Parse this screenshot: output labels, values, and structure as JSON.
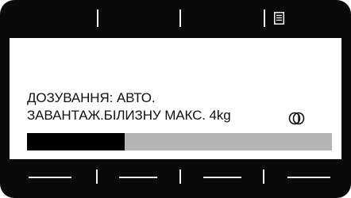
{
  "display": {
    "dosing_line": "ДОЗУВАННЯ: АВТО.",
    "load_line": "ЗАВАНТАЖ.БІЛИЗНУ МАКС. 4kg"
  },
  "icons": {
    "top_right": "menu-list-icon",
    "load_indicator": "drum-icon"
  },
  "progress": {
    "fraction": 0.32
  },
  "colors": {
    "bezel": "#0a0a0a",
    "screen": "#ffffff",
    "progress_track": "#b4b4b4",
    "progress_fill": "#000000"
  }
}
